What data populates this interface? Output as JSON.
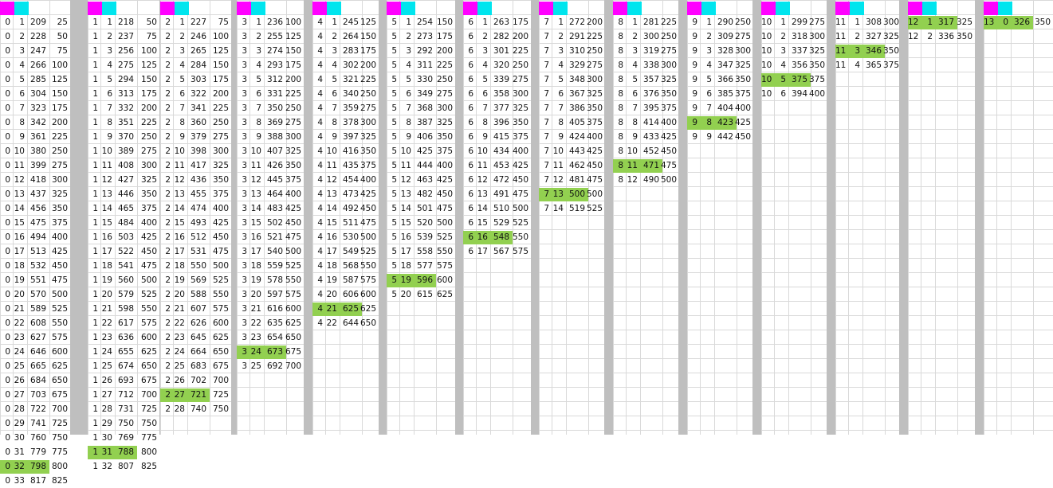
{
  "colors": {
    "grid": "#d9d9d9",
    "separator": "#bfbfbf",
    "header_magenta": "#ff00ff",
    "header_cyan": "#00e5ee",
    "highlight": "#92d050"
  },
  "blocks": [
    {
      "id": "0",
      "rows": [
        [
          0,
          1,
          209,
          25
        ],
        [
          0,
          2,
          228,
          50
        ],
        [
          0,
          3,
          247,
          75
        ],
        [
          0,
          4,
          266,
          100
        ],
        [
          0,
          5,
          285,
          125
        ],
        [
          0,
          6,
          304,
          150
        ],
        [
          0,
          7,
          323,
          175
        ],
        [
          0,
          8,
          342,
          200
        ],
        [
          0,
          9,
          361,
          225
        ],
        [
          0,
          10,
          380,
          250
        ],
        [
          0,
          11,
          399,
          275
        ],
        [
          0,
          12,
          418,
          300
        ],
        [
          0,
          13,
          437,
          325
        ],
        [
          0,
          14,
          456,
          350
        ],
        [
          0,
          15,
          475,
          375
        ],
        [
          0,
          16,
          494,
          400
        ],
        [
          0,
          17,
          513,
          425
        ],
        [
          0,
          18,
          532,
          450
        ],
        [
          0,
          19,
          551,
          475
        ],
        [
          0,
          20,
          570,
          500
        ],
        [
          0,
          21,
          589,
          525
        ],
        [
          0,
          22,
          608,
          550
        ],
        [
          0,
          23,
          627,
          575
        ],
        [
          0,
          24,
          646,
          600
        ],
        [
          0,
          25,
          665,
          625
        ],
        [
          0,
          26,
          684,
          650
        ],
        [
          0,
          27,
          703,
          675
        ],
        [
          0,
          28,
          722,
          700
        ],
        [
          0,
          29,
          741,
          725
        ],
        [
          0,
          30,
          760,
          750
        ],
        [
          0,
          31,
          779,
          775
        ],
        [
          0,
          32,
          798,
          800
        ],
        [
          0,
          33,
          817,
          825
        ]
      ],
      "highlight": 31
    },
    {
      "id": "1",
      "rows": [
        [
          1,
          1,
          218,
          50
        ],
        [
          1,
          2,
          237,
          75
        ],
        [
          1,
          3,
          256,
          100
        ],
        [
          1,
          4,
          275,
          125
        ],
        [
          1,
          5,
          294,
          150
        ],
        [
          1,
          6,
          313,
          175
        ],
        [
          1,
          7,
          332,
          200
        ],
        [
          1,
          8,
          351,
          225
        ],
        [
          1,
          9,
          370,
          250
        ],
        [
          1,
          10,
          389,
          275
        ],
        [
          1,
          11,
          408,
          300
        ],
        [
          1,
          12,
          427,
          325
        ],
        [
          1,
          13,
          446,
          350
        ],
        [
          1,
          14,
          465,
          375
        ],
        [
          1,
          15,
          484,
          400
        ],
        [
          1,
          16,
          503,
          425
        ],
        [
          1,
          17,
          522,
          450
        ],
        [
          1,
          18,
          541,
          475
        ],
        [
          1,
          19,
          560,
          500
        ],
        [
          1,
          20,
          579,
          525
        ],
        [
          1,
          21,
          598,
          550
        ],
        [
          1,
          22,
          617,
          575
        ],
        [
          1,
          23,
          636,
          600
        ],
        [
          1,
          24,
          655,
          625
        ],
        [
          1,
          25,
          674,
          650
        ],
        [
          1,
          26,
          693,
          675
        ],
        [
          1,
          27,
          712,
          700
        ],
        [
          1,
          28,
          731,
          725
        ],
        [
          1,
          29,
          750,
          750
        ],
        [
          1,
          30,
          769,
          775
        ],
        [
          1,
          31,
          788,
          800
        ],
        [
          1,
          32,
          807,
          825
        ]
      ],
      "highlight": 30
    },
    {
      "id": "2",
      "rows": [
        [
          2,
          1,
          227,
          75
        ],
        [
          2,
          2,
          246,
          100
        ],
        [
          2,
          3,
          265,
          125
        ],
        [
          2,
          4,
          284,
          150
        ],
        [
          2,
          5,
          303,
          175
        ],
        [
          2,
          6,
          322,
          200
        ],
        [
          2,
          7,
          341,
          225
        ],
        [
          2,
          8,
          360,
          250
        ],
        [
          2,
          9,
          379,
          275
        ],
        [
          2,
          10,
          398,
          300
        ],
        [
          2,
          11,
          417,
          325
        ],
        [
          2,
          12,
          436,
          350
        ],
        [
          2,
          13,
          455,
          375
        ],
        [
          2,
          14,
          474,
          400
        ],
        [
          2,
          15,
          493,
          425
        ],
        [
          2,
          16,
          512,
          450
        ],
        [
          2,
          17,
          531,
          475
        ],
        [
          2,
          18,
          550,
          500
        ],
        [
          2,
          19,
          569,
          525
        ],
        [
          2,
          20,
          588,
          550
        ],
        [
          2,
          21,
          607,
          575
        ],
        [
          2,
          22,
          626,
          600
        ],
        [
          2,
          23,
          645,
          625
        ],
        [
          2,
          24,
          664,
          650
        ],
        [
          2,
          25,
          683,
          675
        ],
        [
          2,
          26,
          702,
          700
        ],
        [
          2,
          27,
          721,
          725
        ],
        [
          2,
          28,
          740,
          750
        ]
      ],
      "highlight": 26
    },
    {
      "id": "3",
      "rows": [
        [
          3,
          1,
          236,
          100
        ],
        [
          3,
          2,
          255,
          125
        ],
        [
          3,
          3,
          274,
          150
        ],
        [
          3,
          4,
          293,
          175
        ],
        [
          3,
          5,
          312,
          200
        ],
        [
          3,
          6,
          331,
          225
        ],
        [
          3,
          7,
          350,
          250
        ],
        [
          3,
          8,
          369,
          275
        ],
        [
          3,
          9,
          388,
          300
        ],
        [
          3,
          10,
          407,
          325
        ],
        [
          3,
          11,
          426,
          350
        ],
        [
          3,
          12,
          445,
          375
        ],
        [
          3,
          13,
          464,
          400
        ],
        [
          3,
          14,
          483,
          425
        ],
        [
          3,
          15,
          502,
          450
        ],
        [
          3,
          16,
          521,
          475
        ],
        [
          3,
          17,
          540,
          500
        ],
        [
          3,
          18,
          559,
          525
        ],
        [
          3,
          19,
          578,
          550
        ],
        [
          3,
          20,
          597,
          575
        ],
        [
          3,
          21,
          616,
          600
        ],
        [
          3,
          22,
          635,
          625
        ],
        [
          3,
          23,
          654,
          650
        ],
        [
          3,
          24,
          673,
          675
        ],
        [
          3,
          25,
          692,
          700
        ]
      ],
      "highlight": 23
    },
    {
      "id": "4",
      "rows": [
        [
          4,
          1,
          245,
          125
        ],
        [
          4,
          2,
          264,
          150
        ],
        [
          4,
          3,
          283,
          175
        ],
        [
          4,
          4,
          302,
          200
        ],
        [
          4,
          5,
          321,
          225
        ],
        [
          4,
          6,
          340,
          250
        ],
        [
          4,
          7,
          359,
          275
        ],
        [
          4,
          8,
          378,
          300
        ],
        [
          4,
          9,
          397,
          325
        ],
        [
          4,
          10,
          416,
          350
        ],
        [
          4,
          11,
          435,
          375
        ],
        [
          4,
          12,
          454,
          400
        ],
        [
          4,
          13,
          473,
          425
        ],
        [
          4,
          14,
          492,
          450
        ],
        [
          4,
          15,
          511,
          475
        ],
        [
          4,
          16,
          530,
          500
        ],
        [
          4,
          17,
          549,
          525
        ],
        [
          4,
          18,
          568,
          550
        ],
        [
          4,
          19,
          587,
          575
        ],
        [
          4,
          20,
          606,
          600
        ],
        [
          4,
          21,
          625,
          625
        ],
        [
          4,
          22,
          644,
          650
        ]
      ],
      "highlight": 20
    },
    {
      "id": "5",
      "rows": [
        [
          5,
          1,
          254,
          150
        ],
        [
          5,
          2,
          273,
          175
        ],
        [
          5,
          3,
          292,
          200
        ],
        [
          5,
          4,
          311,
          225
        ],
        [
          5,
          5,
          330,
          250
        ],
        [
          5,
          6,
          349,
          275
        ],
        [
          5,
          7,
          368,
          300
        ],
        [
          5,
          8,
          387,
          325
        ],
        [
          5,
          9,
          406,
          350
        ],
        [
          5,
          10,
          425,
          375
        ],
        [
          5,
          11,
          444,
          400
        ],
        [
          5,
          12,
          463,
          425
        ],
        [
          5,
          13,
          482,
          450
        ],
        [
          5,
          14,
          501,
          475
        ],
        [
          5,
          15,
          520,
          500
        ],
        [
          5,
          16,
          539,
          525
        ],
        [
          5,
          17,
          558,
          550
        ],
        [
          5,
          18,
          577,
          575
        ],
        [
          5,
          19,
          596,
          600
        ],
        [
          5,
          20,
          615,
          625
        ]
      ],
      "highlight": 18
    },
    {
      "id": "6",
      "rows": [
        [
          6,
          1,
          263,
          175
        ],
        [
          6,
          2,
          282,
          200
        ],
        [
          6,
          3,
          301,
          225
        ],
        [
          6,
          4,
          320,
          250
        ],
        [
          6,
          5,
          339,
          275
        ],
        [
          6,
          6,
          358,
          300
        ],
        [
          6,
          7,
          377,
          325
        ],
        [
          6,
          8,
          396,
          350
        ],
        [
          6,
          9,
          415,
          375
        ],
        [
          6,
          10,
          434,
          400
        ],
        [
          6,
          11,
          453,
          425
        ],
        [
          6,
          12,
          472,
          450
        ],
        [
          6,
          13,
          491,
          475
        ],
        [
          6,
          14,
          510,
          500
        ],
        [
          6,
          15,
          529,
          525
        ],
        [
          6,
          16,
          548,
          550
        ],
        [
          6,
          17,
          567,
          575
        ]
      ],
      "highlight": 15
    },
    {
      "id": "7",
      "rows": [
        [
          7,
          1,
          272,
          200
        ],
        [
          7,
          2,
          291,
          225
        ],
        [
          7,
          3,
          310,
          250
        ],
        [
          7,
          4,
          329,
          275
        ],
        [
          7,
          5,
          348,
          300
        ],
        [
          7,
          6,
          367,
          325
        ],
        [
          7,
          7,
          386,
          350
        ],
        [
          7,
          8,
          405,
          375
        ],
        [
          7,
          9,
          424,
          400
        ],
        [
          7,
          10,
          443,
          425
        ],
        [
          7,
          11,
          462,
          450
        ],
        [
          7,
          12,
          481,
          475
        ],
        [
          7,
          13,
          500,
          500
        ],
        [
          7,
          14,
          519,
          525
        ]
      ],
      "highlight": 12
    },
    {
      "id": "8",
      "rows": [
        [
          8,
          1,
          281,
          225
        ],
        [
          8,
          2,
          300,
          250
        ],
        [
          8,
          3,
          319,
          275
        ],
        [
          8,
          4,
          338,
          300
        ],
        [
          8,
          5,
          357,
          325
        ],
        [
          8,
          6,
          376,
          350
        ],
        [
          8,
          7,
          395,
          375
        ],
        [
          8,
          8,
          414,
          400
        ],
        [
          8,
          9,
          433,
          425
        ],
        [
          8,
          10,
          452,
          450
        ],
        [
          8,
          11,
          471,
          475
        ],
        [
          8,
          12,
          490,
          500
        ]
      ],
      "highlight": 10
    },
    {
      "id": "9",
      "rows": [
        [
          9,
          1,
          290,
          250
        ],
        [
          9,
          2,
          309,
          275
        ],
        [
          9,
          3,
          328,
          300
        ],
        [
          9,
          4,
          347,
          325
        ],
        [
          9,
          5,
          366,
          350
        ],
        [
          9,
          6,
          385,
          375
        ],
        [
          9,
          7,
          404,
          400
        ],
        [
          9,
          8,
          423,
          425
        ],
        [
          9,
          9,
          442,
          450
        ]
      ],
      "highlight": 7
    },
    {
      "id": "10",
      "rows": [
        [
          10,
          1,
          299,
          275
        ],
        [
          10,
          2,
          318,
          300
        ],
        [
          10,
          3,
          337,
          325
        ],
        [
          10,
          4,
          356,
          350
        ],
        [
          10,
          5,
          375,
          375
        ],
        [
          10,
          6,
          394,
          400
        ]
      ],
      "highlight": 4
    },
    {
      "id": "11",
      "rows": [
        [
          11,
          1,
          308,
          300
        ],
        [
          11,
          2,
          327,
          325
        ],
        [
          11,
          3,
          346,
          350
        ],
        [
          11,
          4,
          365,
          375
        ]
      ],
      "highlight": 2
    },
    {
      "id": "12",
      "rows": [
        [
          12,
          1,
          317,
          325
        ],
        [
          12,
          2,
          336,
          350
        ]
      ],
      "highlight": 0
    },
    {
      "id": "13",
      "rows": [
        [
          13,
          0,
          326,
          350
        ]
      ],
      "highlight": 0
    }
  ]
}
